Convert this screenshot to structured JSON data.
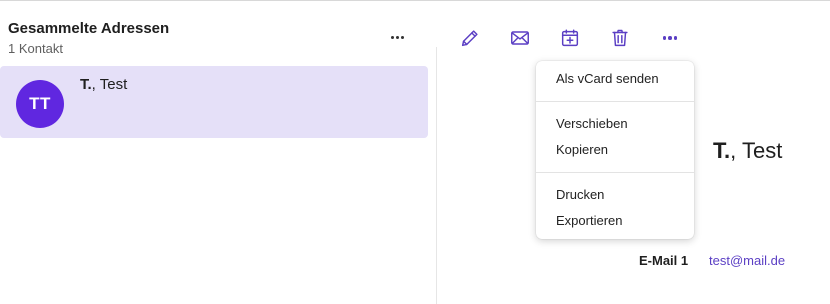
{
  "list": {
    "title": "Gesammelte Adressen",
    "count": "1 Kontakt",
    "more_icon": "more-horizontal-icon"
  },
  "contacts": [
    {
      "initials": "TT",
      "last_name": "T.",
      "first_name": ", Test",
      "avatar_color": "#6027e0"
    }
  ],
  "toolbar": {
    "icons": [
      "pencil-icon",
      "envelope-icon",
      "calendar-add-icon",
      "trash-icon",
      "more-horizontal-icon"
    ],
    "accent_color": "#5b3fc4"
  },
  "detail": {
    "last_name": "T.",
    "first_name": ", Test",
    "email_label": "E-Mail 1",
    "email_value": "test@mail.de"
  },
  "menu": {
    "send_vcard": "Als vCard senden",
    "move": "Verschieben",
    "copy": "Kopieren",
    "print": "Drucken",
    "export": "Exportieren"
  },
  "colors": {
    "selected_bg": "#e5e0f8",
    "accent": "#5b3fc4"
  }
}
